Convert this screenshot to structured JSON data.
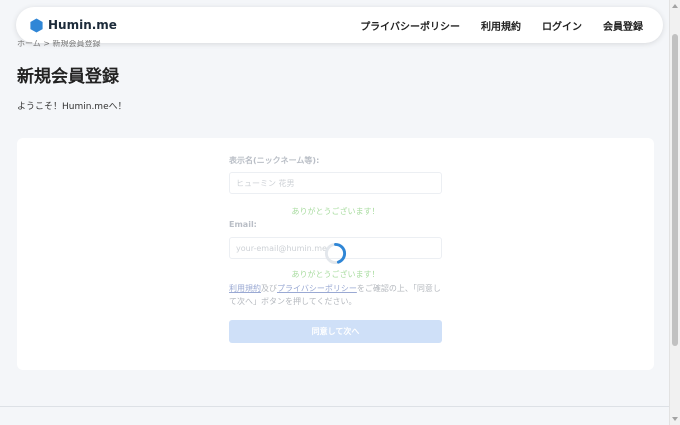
{
  "navbar": {
    "brand": "Humin.me",
    "links": [
      "プライバシーポリシー",
      "利用規約",
      "ログイン",
      "会員登録"
    ]
  },
  "breadcrumb": "ホーム > 新規会員登録",
  "page": {
    "title": "新規会員登録",
    "welcome": "ようこそ！Humin.meへ！"
  },
  "form": {
    "nickname_label": "表示名(ニックネーム等):",
    "nickname_placeholder": "ヒューミン 花男",
    "nickname_success": "ありがとうございます！",
    "email_label": "Email:",
    "email_placeholder": "your-email@humin.me",
    "email_success": "ありがとうございます！",
    "consent_terms_link": "利用規約",
    "consent_and": "及び",
    "consent_privacy_link": "プライバシーポリシー",
    "consent_text": "をご確認の上、「同意して次へ」ボタンを押してください。",
    "submit_label": "同意して次へ"
  },
  "colors": {
    "brand_logo": "#2f86d6",
    "submit_disabled": "#cfe0f8",
    "success_text": "#a9dca0",
    "spinner": "#2f86d6"
  },
  "icons": {
    "brand": "hexagon-logo-icon",
    "loading": "loading-spinner-icon"
  }
}
